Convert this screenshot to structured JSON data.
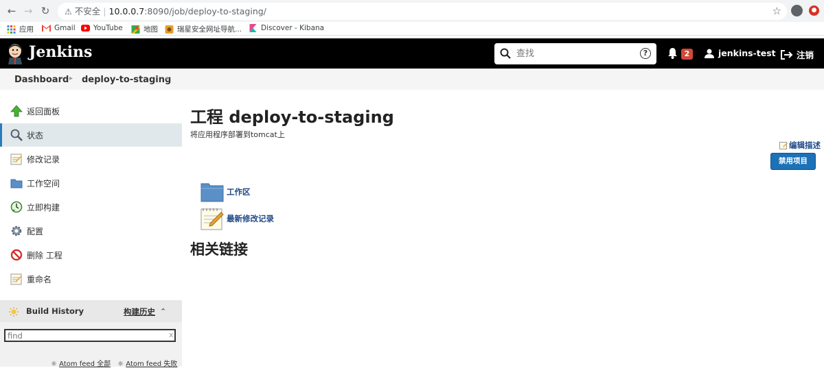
{
  "browser": {
    "insecure_label": "不安全",
    "url_host": "10.0.0.7",
    "url_path": ":8090/job/deploy-to-staging/",
    "bookmarks": [
      {
        "label": "应用",
        "icon": "apps-grid-icon"
      },
      {
        "label": "Gmail",
        "icon": "gmail-icon"
      },
      {
        "label": "YouTube",
        "icon": "youtube-icon"
      },
      {
        "label": "地图",
        "icon": "maps-icon"
      },
      {
        "label": "瑞星安全网址导航...",
        "icon": "rising-icon"
      },
      {
        "label": "Discover - Kibana",
        "icon": "kibana-icon"
      }
    ]
  },
  "header": {
    "title": "Jenkins",
    "search_placeholder": "查找",
    "notification_count": "2",
    "username": "jenkins-test",
    "logout_label": "注销"
  },
  "breadcrumb": [
    "Dashboard",
    "deploy-to-staging"
  ],
  "sidebar": {
    "items": [
      {
        "label": "返回面板",
        "icon": "up-arrow-icon"
      },
      {
        "label": "状态",
        "icon": "magnifier-icon"
      },
      {
        "label": "修改记录",
        "icon": "notepad-icon"
      },
      {
        "label": "工作空间",
        "icon": "folder-icon"
      },
      {
        "label": "立即构建",
        "icon": "build-clock-icon"
      },
      {
        "label": "配置",
        "icon": "gear-icon"
      },
      {
        "label": "删除 工程",
        "icon": "no-entry-icon"
      },
      {
        "label": "重命名",
        "icon": "notepad-icon"
      }
    ],
    "active_index": 1,
    "build_history": {
      "title": "Build History",
      "link": "构建历史",
      "find_placeholder": "find",
      "feeds": [
        "Atom feed 全部",
        "Atom feed 失败"
      ]
    }
  },
  "main": {
    "title": "工程 deploy-to-staging",
    "description": "将应用程序部署到tomcat上",
    "edit_description": "编辑描述",
    "disable_button": "禁用项目",
    "links": [
      {
        "label": "工作区",
        "icon": "folder-icon"
      },
      {
        "label": "最新修改记录",
        "icon": "notepad-icon"
      }
    ],
    "related_heading": "相关链接"
  },
  "colors": {
    "header_bg": "#000000",
    "accent_blue": "#1c71b7",
    "link_blue": "#204a87",
    "badge_red": "#d24939"
  }
}
